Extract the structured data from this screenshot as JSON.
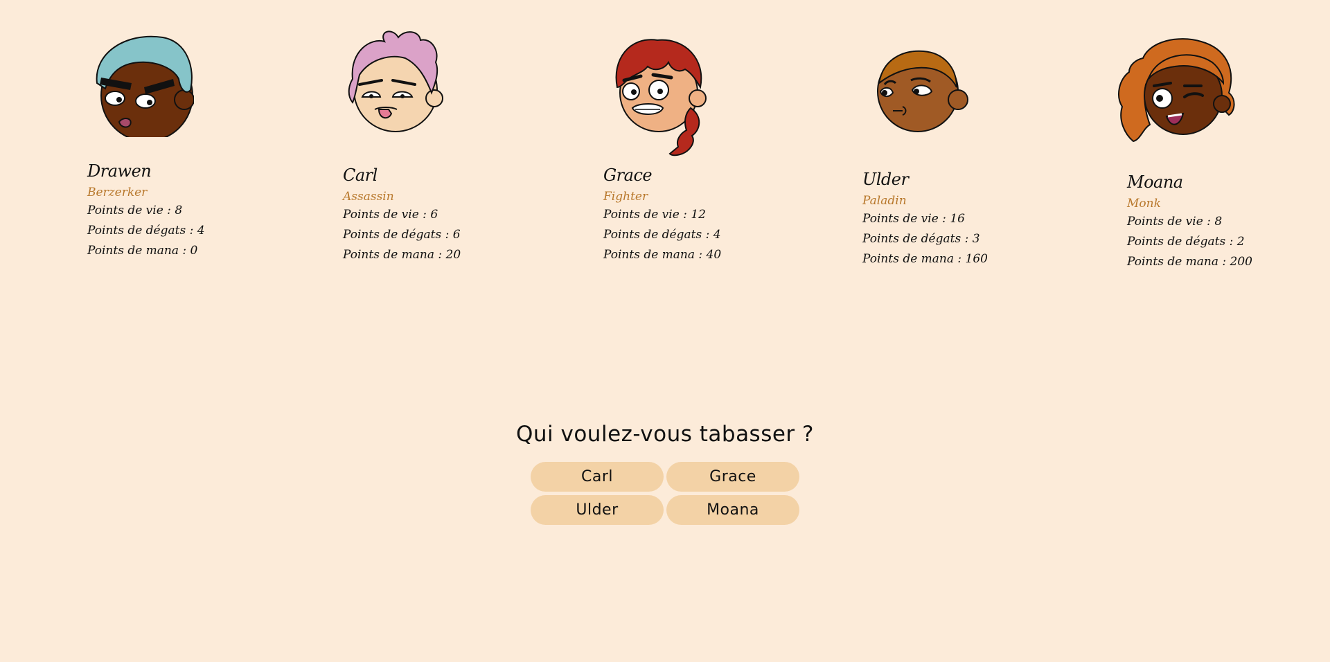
{
  "colors": {
    "background": "#fcebd9",
    "class_text": "#b8782c",
    "button_bg": "#f3d2a6"
  },
  "characters": [
    {
      "name": "Drawen",
      "class": "Berzerker",
      "stats": [
        "Points de vie : 8",
        "Points de dégats : 4",
        "Points de mana : 0"
      ],
      "portrait": "drawen-portrait-icon"
    },
    {
      "name": "Carl",
      "class": "Assassin",
      "stats": [
        "Points de vie : 6",
        "Points de dégats : 6",
        "Points de mana : 20"
      ],
      "portrait": "carl-portrait-icon"
    },
    {
      "name": "Grace",
      "class": "Fighter",
      "stats": [
        "Points de vie : 12",
        "Points de dégats : 4",
        "Points de mana : 40"
      ],
      "portrait": "grace-portrait-icon"
    },
    {
      "name": "Ulder",
      "class": "Paladin",
      "stats": [
        "Points de vie : 16",
        "Points de dégats : 3",
        "Points de mana : 160"
      ],
      "portrait": "ulder-portrait-icon"
    },
    {
      "name": "Moana",
      "class": "Monk",
      "stats": [
        "Points de vie : 8",
        "Points de dégats : 2",
        "Points de mana : 200"
      ],
      "portrait": "moana-portrait-icon"
    }
  ],
  "prompt": {
    "question": "Qui voulez-vous tabasser ?",
    "targets": [
      "Carl",
      "Grace",
      "Ulder",
      "Moana"
    ]
  }
}
